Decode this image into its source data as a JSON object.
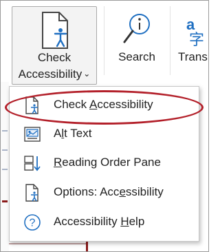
{
  "ribbon": {
    "check_accessibility": {
      "line1": "Check",
      "line2": "Accessibility",
      "chevron": "⌄",
      "icon": "check-accessibility-icon"
    },
    "search": {
      "label": "Search",
      "icon": "search-icon"
    },
    "translate": {
      "label": "Trans",
      "icon": "translate-icon"
    }
  },
  "menu": {
    "items": [
      {
        "icon": "check-accessibility-icon",
        "pre": "Check ",
        "ul": "A",
        "post": "ccessibility",
        "highlighted": true
      },
      {
        "icon": "alt-text-icon",
        "pre": "A",
        "ul": "l",
        "post": "t Text"
      },
      {
        "icon": "reading-order-pane-icon",
        "pre": "",
        "ul": "R",
        "post": "eading Order Pane"
      },
      {
        "icon": "options-accessibility-icon",
        "pre": "Options: Acc",
        "ul": "e",
        "post": "ssibility"
      },
      {
        "icon": "accessibility-help-icon",
        "pre": "Accessibility ",
        "ul": "H",
        "post": "elp"
      }
    ]
  },
  "colors": {
    "highlight_oval": "#b3202a",
    "accent_blue": "#1f6fc1"
  }
}
